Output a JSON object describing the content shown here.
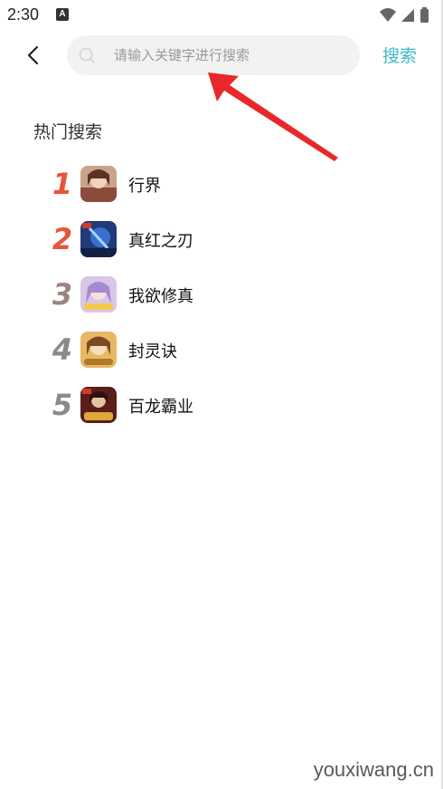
{
  "status_bar": {
    "time": "2:30",
    "notification_letter": "A"
  },
  "header": {
    "search_placeholder": "请输入关键字进行搜索",
    "search_button_label": "搜索"
  },
  "hot_search": {
    "title": "热门搜索",
    "items": [
      {
        "rank": "1",
        "name": "行界",
        "rank_color": "#e8553a"
      },
      {
        "rank": "2",
        "name": "真红之刃",
        "rank_color": "#e8553a"
      },
      {
        "rank": "3",
        "name": "我欲修真",
        "rank_color": "#9a8583"
      },
      {
        "rank": "4",
        "name": "封灵诀",
        "rank_color": "#8a8a8a"
      },
      {
        "rank": "5",
        "name": "百龙霸业",
        "rank_color": "#8a8a8a"
      }
    ]
  },
  "watermark": "youxiwang.cn",
  "colors": {
    "accent": "#3db8c8",
    "arrow": "#e8282a"
  }
}
